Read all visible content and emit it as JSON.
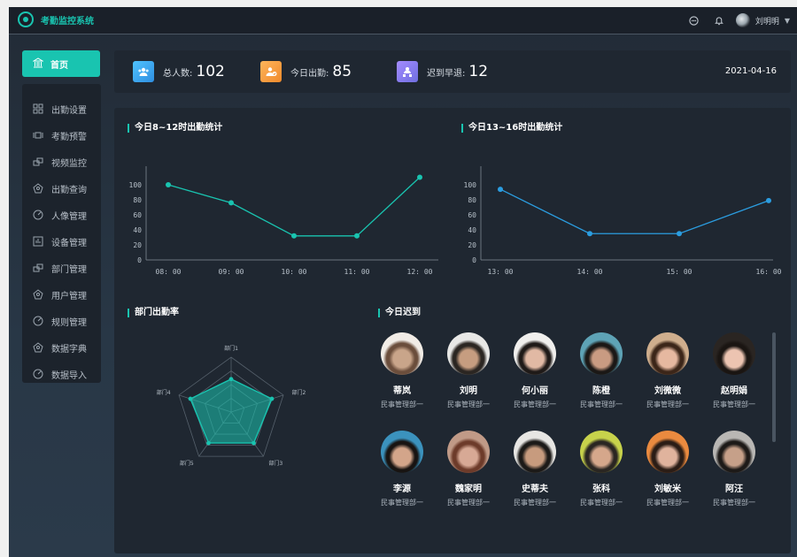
{
  "app": {
    "title": "考勤监控系统"
  },
  "topbar": {
    "username": "刘明明"
  },
  "menu": {
    "home": "首页",
    "items": [
      {
        "label": "出勤设置",
        "icon": "grid-icon"
      },
      {
        "label": "考勤预警",
        "icon": "alarm-icon"
      },
      {
        "label": "视频监控",
        "icon": "video-icon"
      },
      {
        "label": "出勤查询",
        "icon": "search-icon"
      },
      {
        "label": "人像管理",
        "icon": "portrait-icon"
      },
      {
        "label": "设备管理",
        "icon": "device-icon"
      },
      {
        "label": "部门管理",
        "icon": "department-icon"
      },
      {
        "label": "用户管理",
        "icon": "user-icon"
      },
      {
        "label": "规则管理",
        "icon": "rule-icon"
      },
      {
        "label": "数据字典",
        "icon": "dictionary-icon"
      },
      {
        "label": "数据导入",
        "icon": "import-icon"
      }
    ]
  },
  "stats": {
    "total_label": "总人数:",
    "total_value": "102",
    "present_label": "今日出勤:",
    "present_value": "85",
    "late_label": "迟到早退:",
    "late_value": "12",
    "date": "2021-04-16",
    "colors": {
      "total": "#2f9be0",
      "present": "#f29c3c",
      "late": "#7c7ee6"
    }
  },
  "panels": {
    "morning_title": "今日8~12时出勤统计",
    "afternoon_title": "今日13~16时出勤统计",
    "dept_title": "部门出勤率",
    "late_title": "今日迟到"
  },
  "chart_data": [
    {
      "type": "line",
      "title": "今日8~12时出勤统计",
      "x": [
        "08: 00",
        "09: 00",
        "10: 00",
        "11: 00",
        "12: 00"
      ],
      "series": [
        {
          "values": [
            100,
            76,
            32,
            32,
            110
          ]
        }
      ],
      "yticks": [
        0,
        20,
        40,
        60,
        80,
        100
      ],
      "ylim": [
        0,
        120
      ],
      "color": "#19c4b0"
    },
    {
      "type": "line",
      "title": "今日13~16时出勤统计",
      "x": [
        "13: 00",
        "14: 00",
        "15: 00",
        "16: 00"
      ],
      "series": [
        {
          "values": [
            94,
            35,
            35,
            79
          ]
        }
      ],
      "yticks": [
        0,
        20,
        40,
        60,
        80,
        100
      ],
      "ylim": [
        0,
        120
      ],
      "color": "#2b9de0"
    },
    {
      "type": "radar",
      "title": "部门出勤率",
      "indicators": [
        "部门1",
        "部门2",
        "部门3",
        "部门4",
        "部门5"
      ],
      "values": [
        0.6,
        0.78,
        0.7,
        0.78,
        0.7
      ],
      "max": 1,
      "color": "#19c4b0"
    }
  ],
  "late_people": [
    {
      "name": "蒂岚",
      "dept": "民事管理部一",
      "face": [
        "#f1ece6",
        "#c9a58a",
        "#6b4e3c"
      ]
    },
    {
      "name": "刘明",
      "dept": "民事管理部一",
      "face": [
        "#e8e8e6",
        "#c69d80",
        "#2b2622"
      ]
    },
    {
      "name": "何小丽",
      "dept": "民事管理部一",
      "face": [
        "#f0efed",
        "#e1b9a4",
        "#1f1a18"
      ]
    },
    {
      "name": "陈橙",
      "dept": "民事管理部一",
      "face": [
        "#5ea3b6",
        "#c99b82",
        "#1b1816"
      ]
    },
    {
      "name": "刘微微",
      "dept": "民事管理部一",
      "face": [
        "#cfae8d",
        "#e6b8a0",
        "#3c2619"
      ]
    },
    {
      "name": "赵明娟",
      "dept": "民事管理部一",
      "face": [
        "#2a2522",
        "#ecc4b1",
        "#1a1512"
      ]
    },
    {
      "name": "李源",
      "dept": "民事管理部一",
      "face": [
        "#3b92bd",
        "#d3a58a",
        "#181412"
      ]
    },
    {
      "name": "魏家明",
      "dept": "民事管理部一",
      "face": [
        "#c09a87",
        "#d7a995",
        "#6d3b2a"
      ]
    },
    {
      "name": "史蒂夫",
      "dept": "民事管理部一",
      "face": [
        "#e7e6e3",
        "#c79b7e",
        "#1c1a18"
      ]
    },
    {
      "name": "张科",
      "dept": "民事管理部一",
      "face": [
        "#c7d24b",
        "#d5a78b",
        "#2a2622"
      ]
    },
    {
      "name": "刘敏米",
      "dept": "民事管理部一",
      "face": [
        "#ea8a3f",
        "#e0b39d",
        "#2b1d16"
      ]
    },
    {
      "name": "阿汪",
      "dept": "民事管理部一",
      "face": [
        "#b9b7b4",
        "#c6a089",
        "#1d1a18"
      ]
    }
  ]
}
